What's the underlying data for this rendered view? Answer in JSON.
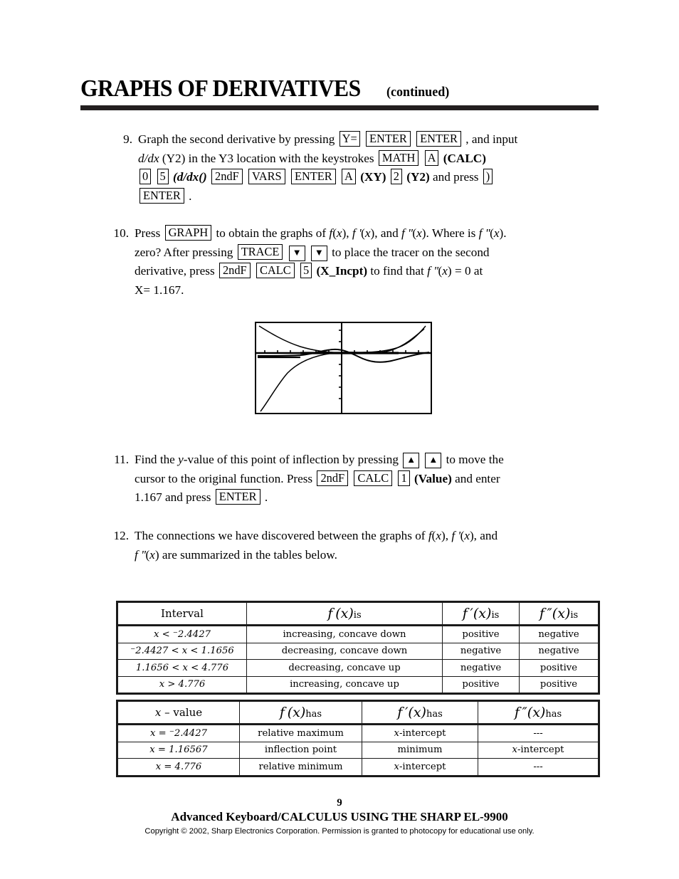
{
  "header": {
    "title": "GRAPHS OF DERIVATIVES",
    "continued": "(continued)"
  },
  "steps": [
    {
      "number": "9.",
      "lines": [
        "Graph the second derivative by pressing",
        "(Y2) in the Y3 location with the keystrokes",
        "and press",
        "."
      ],
      "keys": [
        "Y=",
        "ENTER",
        "ENTER",
        "MATH",
        "A",
        "0",
        "5",
        "2ndF",
        "VARS",
        "ENTER",
        "A",
        "2",
        ")",
        "ENTER"
      ],
      "labels": [
        "(CALC)",
        "(d/dx()",
        "(XY)",
        "(Y2)"
      ],
      "tail_1": ", and input",
      "ddx": "d/dx"
    },
    {
      "number": "10.",
      "text_a": "Press",
      "text_b": "to obtain the graphs of",
      "text_c": "Where is",
      "text_d": "zero?  After pressing",
      "text_e": "to place the tracer on the second",
      "text_f": "derivative, press",
      "text_g": "to find that",
      "text_h": "= 0 at",
      "text_i": "X= 1.167.",
      "keys": [
        "GRAPH",
        "TRACE",
        "2ndF",
        "CALC",
        "5"
      ],
      "label": "(X_Incpt)"
    },
    {
      "number": "11.",
      "text_a": "Find the",
      "text_b": "-value of this point of inflection by pressing",
      "text_c": "to move the",
      "text_d": "cursor to the original function.  Press",
      "text_e": "and enter",
      "text_f": "1.167 and press",
      "text_g": ".",
      "keys": [
        "2ndF",
        "CALC",
        "1",
        "ENTER"
      ],
      "label": "(Value)"
    },
    {
      "number": "12.",
      "text_a": "The connections we have discovered between the graphs of",
      "text_b": "are summarized in the tables below."
    }
  ],
  "graph": {
    "caption": "calculator-graph-screen"
  },
  "table1": {
    "headers": [
      "Interval",
      "f(x) is",
      "f'(x) is",
      "f\"(x) is"
    ],
    "header_sub": "is",
    "rows": [
      [
        "x < ⁻2.4427",
        "increasing, concave down",
        "positive",
        "negative"
      ],
      [
        "⁻2.4427 < x < 1.1656",
        "decreasing, concave down",
        "negative",
        "negative"
      ],
      [
        "1.1656 < x < 4.776",
        "decreasing, concave up",
        "negative",
        "positive"
      ],
      [
        "x > 4.776",
        "increasing, concave up",
        "positive",
        "positive"
      ]
    ]
  },
  "table2": {
    "headers": [
      "x – value",
      "f(x) has",
      "f'(x) has",
      "f\"(x) has"
    ],
    "header_sub": "has",
    "rows": [
      [
        "x = ⁻2.4427",
        "relative maximum",
        "x-intercept",
        "---"
      ],
      [
        "x = 1.16567",
        "inflection point",
        "minimum",
        "x-intercept"
      ],
      [
        "x = 4.776",
        "relative minimum",
        "x-intercept",
        "---"
      ]
    ]
  },
  "footer": {
    "page_number": "9",
    "title": "Advanced Keyboard/CALCULUS USING THE SHARP EL-9900",
    "copyright": "Copyright © 2002, Sharp Electronics Corporation.  Permission is granted to photocopy for educational use only."
  }
}
